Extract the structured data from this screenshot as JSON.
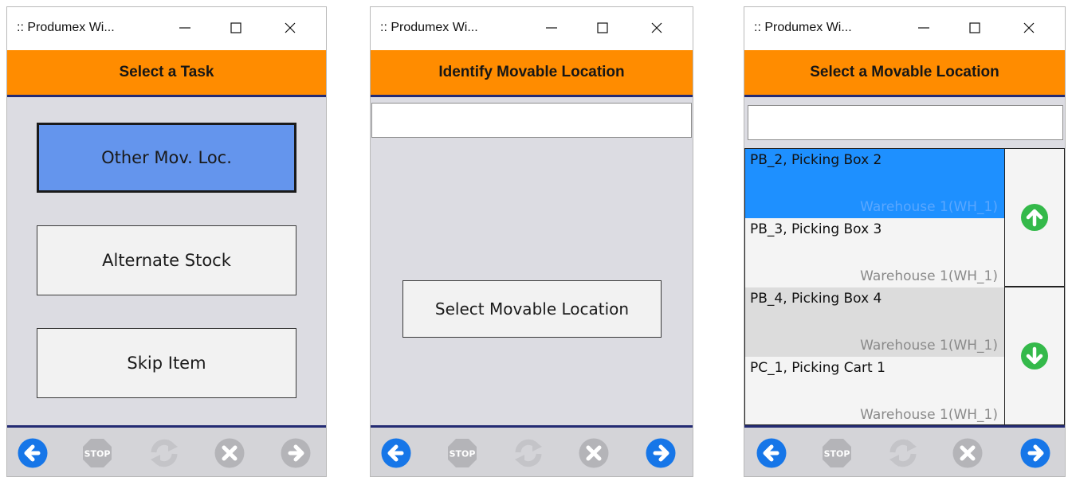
{
  "colors": {
    "header_bg": "#ff8c00",
    "header_rule": "#232b73",
    "content_bg": "#dcdce2",
    "selected_task": "#6495ed",
    "selected_row": "#1e90ff",
    "nav_blue": "#1676e8",
    "nav_disabled": "#b4b4b8",
    "scroll_green": "#34b94a"
  },
  "footer_icons": [
    "arrow-left-icon",
    "stop-icon",
    "refresh-icon",
    "cancel-icon",
    "arrow-right-icon"
  ],
  "windows": [
    {
      "title": ":: Produmex Wi...",
      "header": "Select a Task",
      "buttons": [
        {
          "label": "Other Mov. Loc.",
          "selected": true
        },
        {
          "label": "Alternate Stock",
          "selected": false
        },
        {
          "label": "Skip Item",
          "selected": false
        }
      ],
      "footer": {
        "back_enabled": true,
        "stop_label": "STOP",
        "next_enabled": false
      }
    },
    {
      "title": ":: Produmex Wi...",
      "header": "Identify Movable Location",
      "scan_value": "",
      "select_button": "Select Movable Location",
      "footer": {
        "back_enabled": true,
        "stop_label": "STOP",
        "next_enabled": true
      }
    },
    {
      "title": ":: Produmex Wi...",
      "header": "Select a Movable Location",
      "scan_value": "",
      "rows": [
        {
          "name": "PB_2, Picking Box 2",
          "warehouse": "Warehouse 1(WH_1)",
          "state": "selected"
        },
        {
          "name": "PB_3, Picking Box 3",
          "warehouse": "Warehouse 1(WH_1)",
          "state": "normal"
        },
        {
          "name": "PB_4, Picking Box 4",
          "warehouse": "Warehouse 1(WH_1)",
          "state": "alternate"
        },
        {
          "name": "PC_1, Picking Cart 1",
          "warehouse": "Warehouse 1(WH_1)",
          "state": "normal"
        }
      ],
      "scroll_icons": [
        "arrow-up-icon",
        "arrow-down-icon"
      ],
      "footer": {
        "back_enabled": true,
        "stop_label": "STOP",
        "next_enabled": true
      }
    }
  ]
}
